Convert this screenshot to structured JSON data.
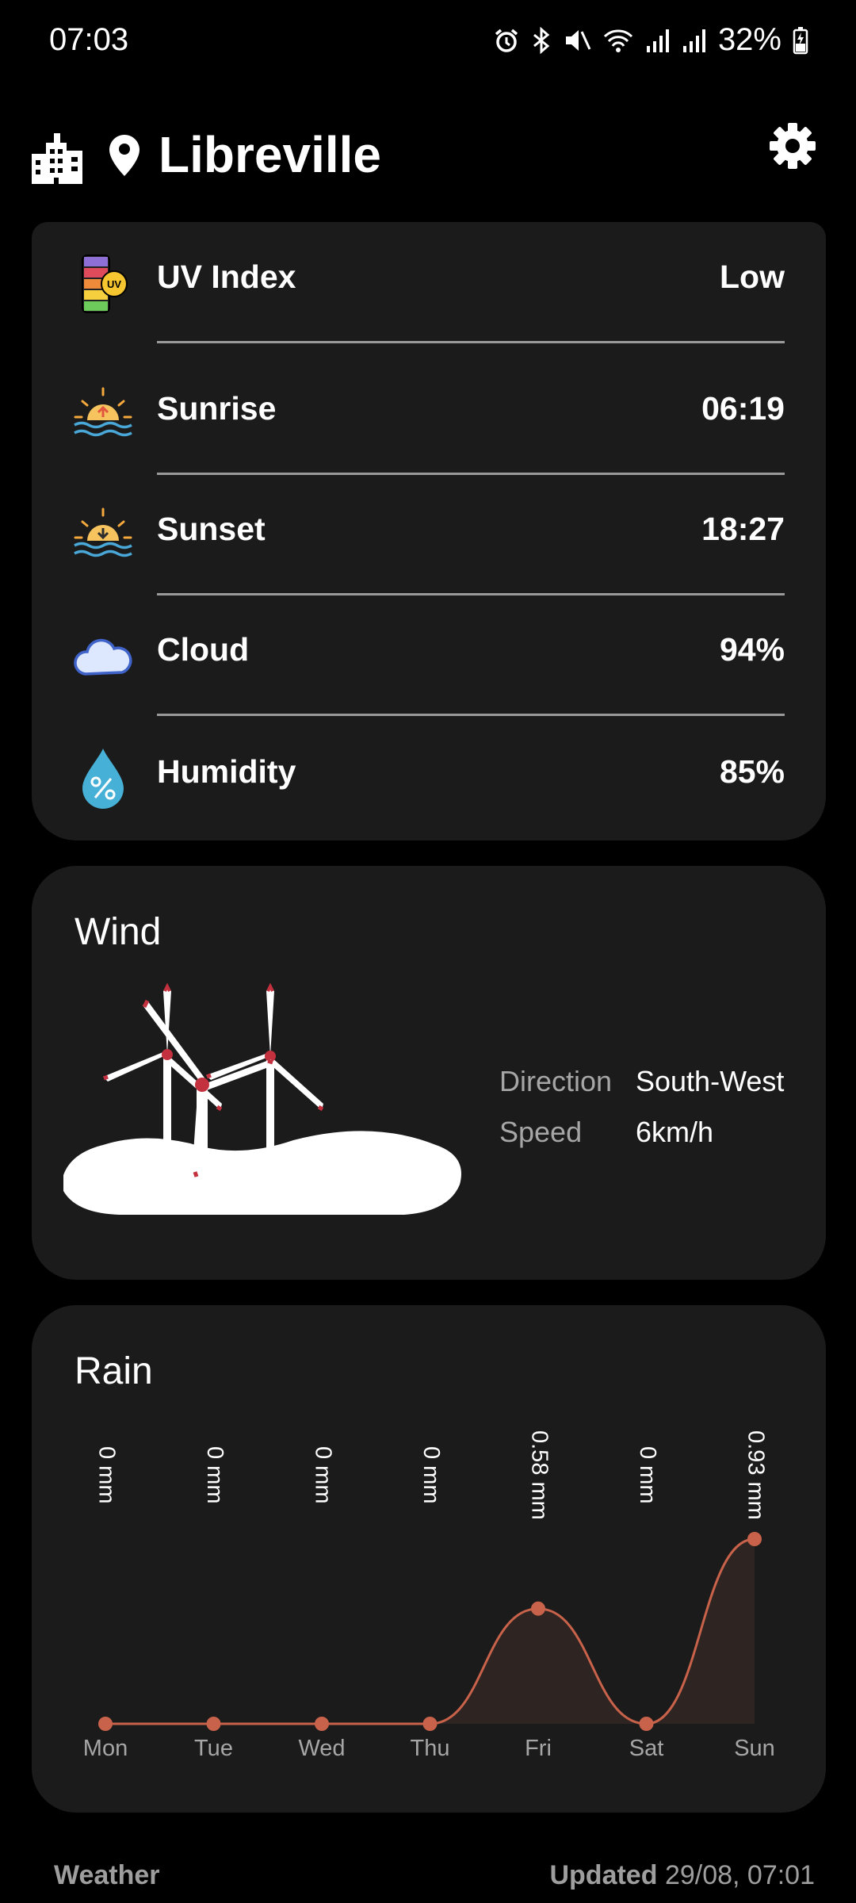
{
  "status_bar": {
    "time": "07:03",
    "battery": "32%"
  },
  "header": {
    "location": "Libreville"
  },
  "details": [
    {
      "icon": "uv-index-icon",
      "label": "UV Index",
      "value": "Low"
    },
    {
      "icon": "sunrise-icon",
      "label": "Sunrise",
      "value": "06:19"
    },
    {
      "icon": "sunset-icon",
      "label": "Sunset",
      "value": "18:27"
    },
    {
      "icon": "cloud-icon",
      "label": "Cloud",
      "value": "94%"
    },
    {
      "icon": "humidity-icon",
      "label": "Humidity",
      "value": "85%"
    }
  ],
  "wind": {
    "title": "Wind",
    "direction_label": "Direction",
    "direction": "South-West",
    "speed_label": "Speed",
    "speed": "6km/h"
  },
  "rain": {
    "title": "Rain"
  },
  "chart_data": {
    "type": "area",
    "categories": [
      "Mon",
      "Tue",
      "Wed",
      "Thu",
      "Fri",
      "Sat",
      "Sun"
    ],
    "values": [
      0,
      0,
      0,
      0,
      0.58,
      0,
      0.93
    ],
    "labels": [
      "0 mm",
      "0 mm",
      "0 mm",
      "0 mm",
      "0.58 mm",
      "0 mm",
      "0.93 mm"
    ],
    "color": "#c8624a",
    "grid": false
  },
  "footer": {
    "app_name": "Weather",
    "updated_label": "Updated",
    "updated_time": "29/08, 07:01"
  }
}
